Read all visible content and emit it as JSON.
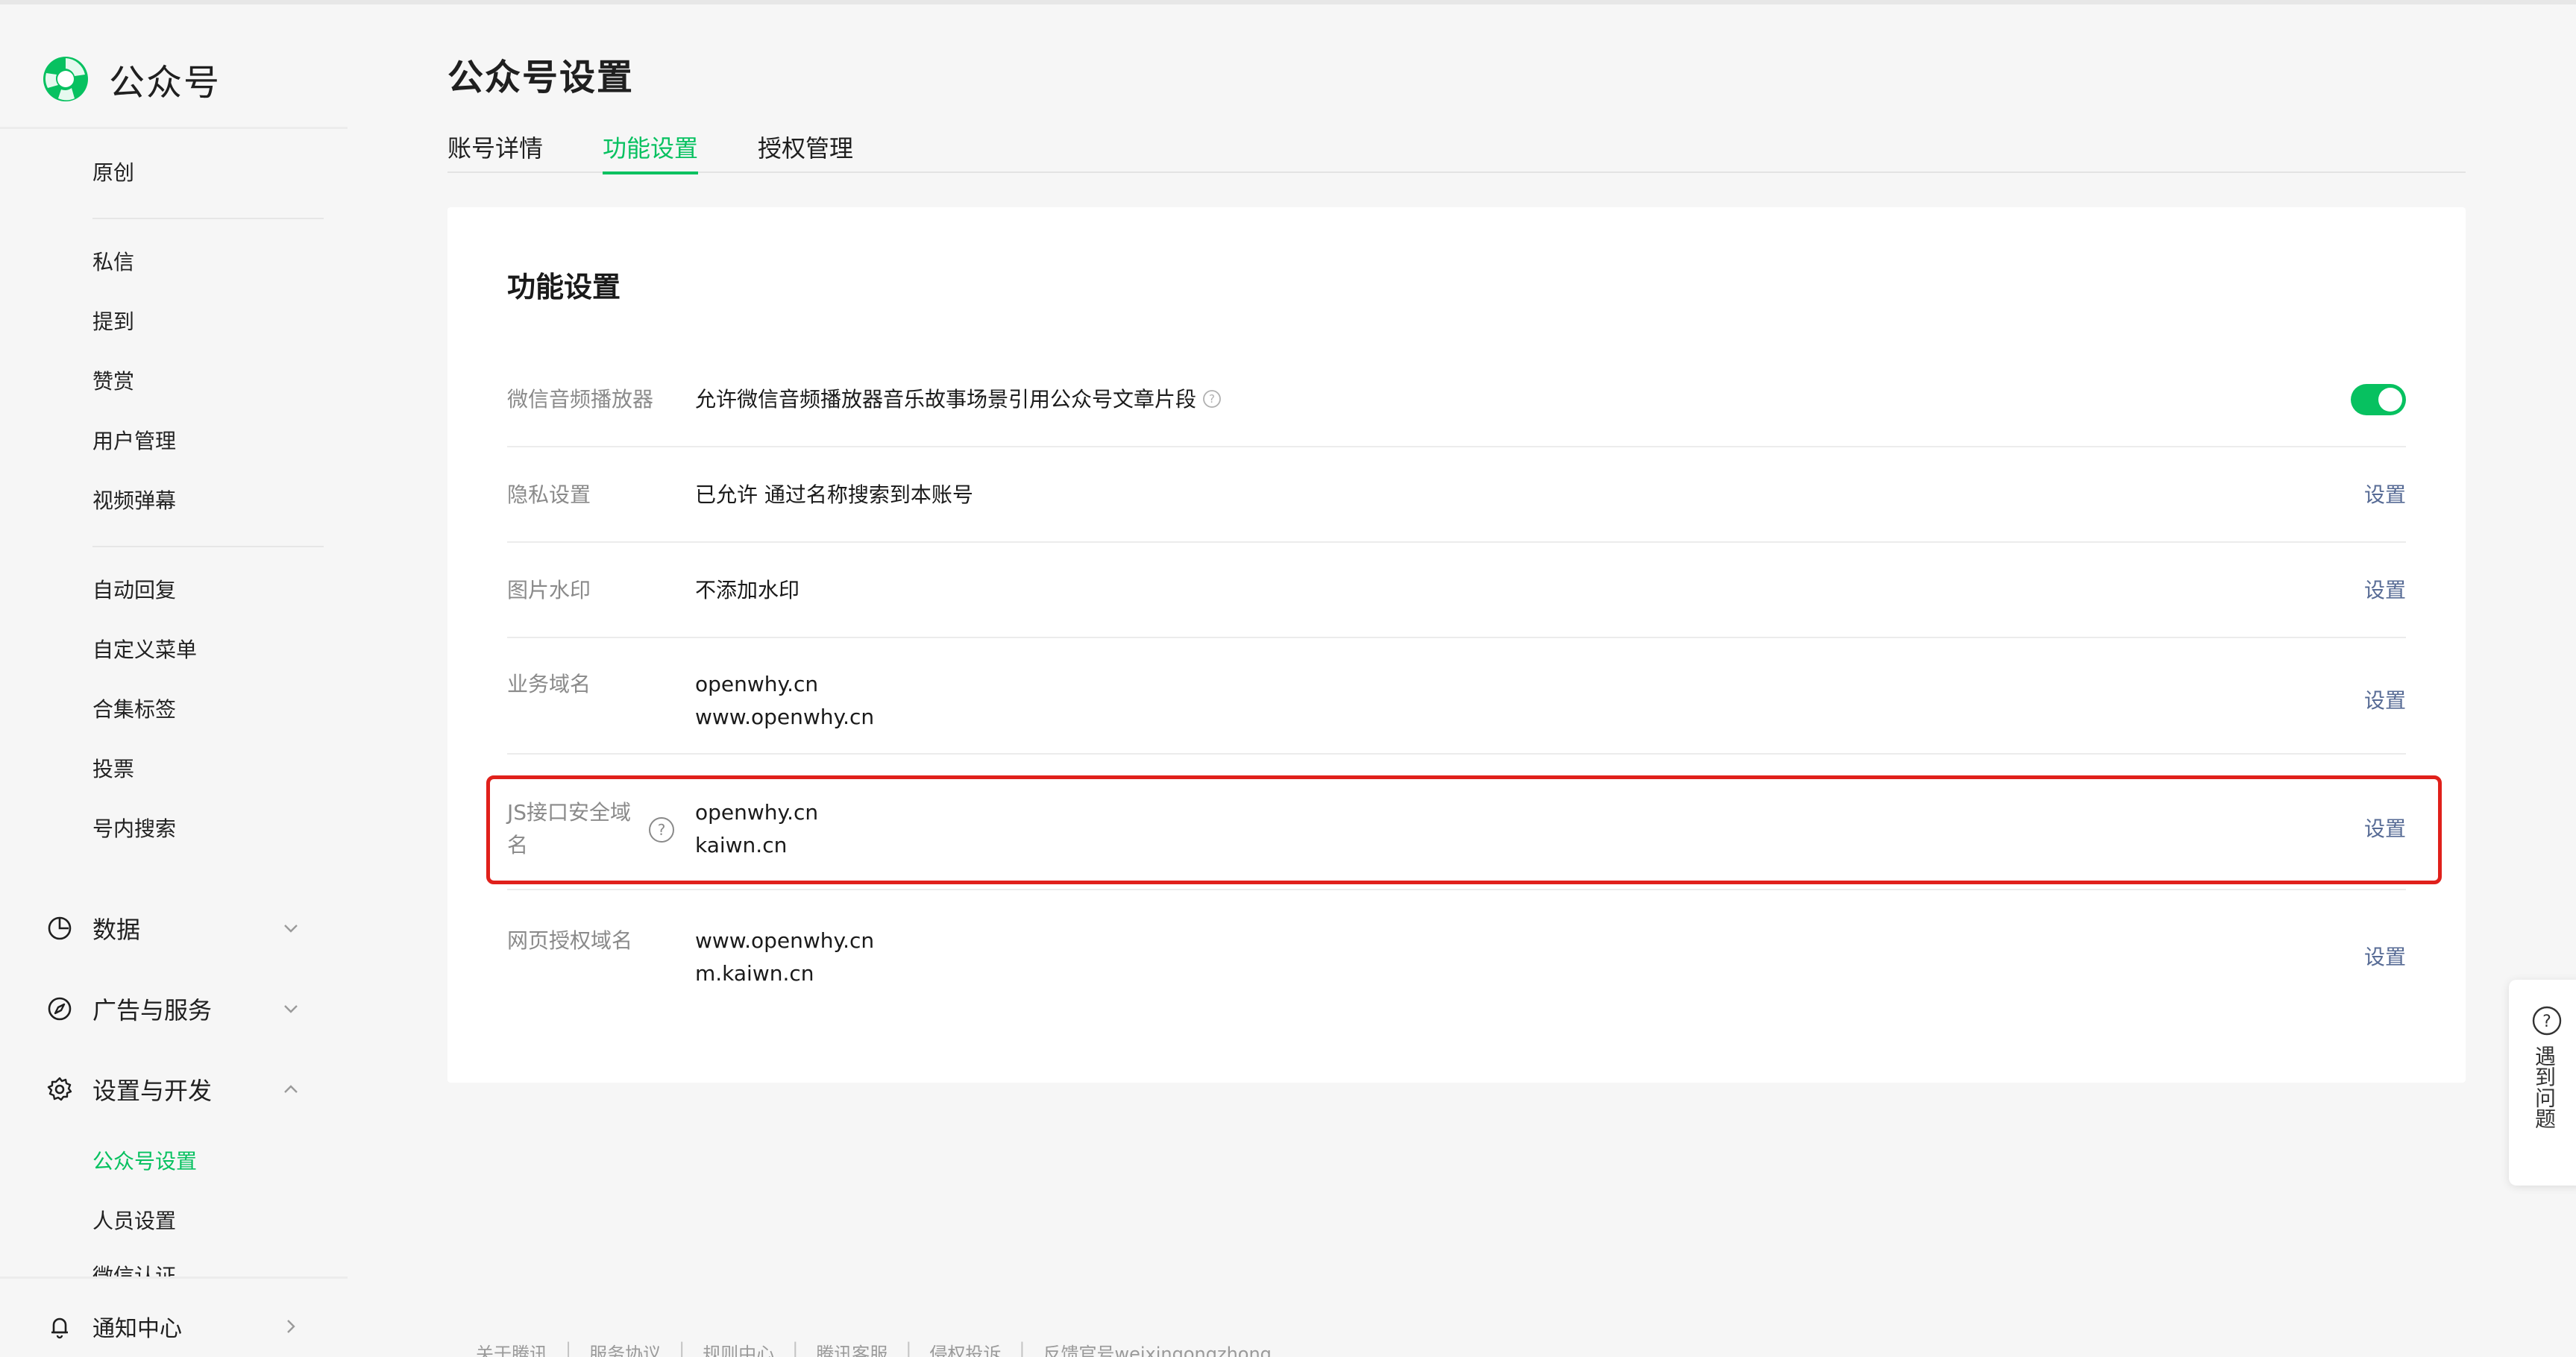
{
  "brand": {
    "name": "公众号",
    "color": "#07c160",
    "icon": "wechat-official-account-logo"
  },
  "sidebar": {
    "section1": [
      {
        "label": "原创"
      }
    ],
    "section2": [
      {
        "label": "私信"
      },
      {
        "label": "提到"
      },
      {
        "label": "赞赏"
      },
      {
        "label": "用户管理"
      },
      {
        "label": "视频弹幕"
      }
    ],
    "section3": [
      {
        "label": "自动回复"
      },
      {
        "label": "自定义菜单"
      },
      {
        "label": "合集标签"
      },
      {
        "label": "投票"
      },
      {
        "label": "号内搜索"
      }
    ],
    "groups": [
      {
        "label": "数据",
        "icon": "pie-chart-icon",
        "expanded": false
      },
      {
        "label": "广告与服务",
        "icon": "compass-icon",
        "expanded": false
      },
      {
        "label": "设置与开发",
        "icon": "gear-icon",
        "expanded": true
      }
    ],
    "sub_items": [
      {
        "label": "公众号设置",
        "active": true
      },
      {
        "label": "人员设置",
        "active": false
      },
      {
        "label": "微信认证",
        "active": false
      }
    ],
    "notify": {
      "label": "通知中心",
      "icon": "bell-icon"
    }
  },
  "page": {
    "title": "公众号设置",
    "tabs": [
      {
        "label": "账号详情"
      },
      {
        "label": "功能设置",
        "active": true
      },
      {
        "label": "授权管理"
      }
    ]
  },
  "card": {
    "title": "功能设置",
    "rows": [
      {
        "label": "微信音频播放器",
        "value": "允许微信音频播放器音乐故事场景引用公众号文章片段",
        "toggle_on": true
      },
      {
        "label": "隐私设置",
        "value": "已允许 通过名称搜索到本账号",
        "action": "设置"
      },
      {
        "label": "图片水印",
        "value": "不添加水印",
        "action": "设置"
      },
      {
        "label": "业务域名",
        "values": [
          "openwhy.cn",
          "www.openwhy.cn"
        ],
        "action": "设置"
      },
      {
        "label_lines": [
          "JS接口安全域",
          "名"
        ],
        "values": [
          "openwhy.cn",
          "kaiwn.cn"
        ],
        "action": "设置",
        "highlighted": true
      },
      {
        "label": "网页授权域名",
        "values": [
          "www.openwhy.cn",
          "m.kaiwn.cn"
        ],
        "action": "设置"
      }
    ]
  },
  "float_help": {
    "label": "遇到问题"
  },
  "footer": {
    "links": [
      "关于腾讯",
      "服务协议",
      "规则中心",
      "腾讯客服",
      "侵权投诉",
      "反馈官号weixingongzhong"
    ]
  },
  "colors": {
    "accent": "#07c160",
    "link": "#576b95",
    "highlight": "#e0201b"
  }
}
